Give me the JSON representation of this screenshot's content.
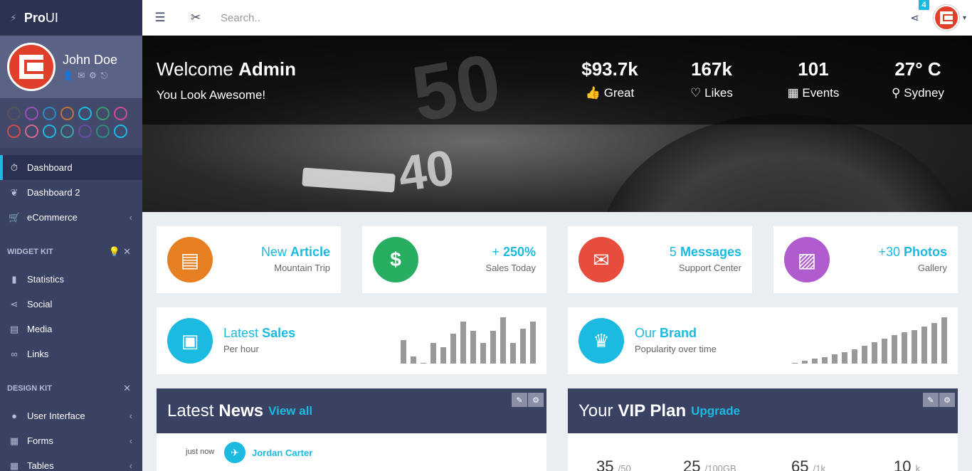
{
  "brand": {
    "bold": "Pro",
    "light": "UI"
  },
  "user": {
    "name": "John Doe"
  },
  "theme_colors": [
    "#555",
    "#9b4dba",
    "#2a8cbd",
    "#c0703a",
    "#1bbae1",
    "#3a9a6a",
    "#d04a9a",
    "#d04a4a",
    "#d06a8a",
    "#1bbae1",
    "#3aa3a3",
    "#6a4aa3",
    "#2a8c7a",
    "#1bbae1"
  ],
  "search": {
    "placeholder": "Search.."
  },
  "notifications": {
    "count": "4"
  },
  "nav": {
    "dashboard": "Dashboard",
    "dashboard2": "Dashboard 2",
    "ecommerce": "eCommerce",
    "widget_kit": "WIDGET KIT",
    "statistics": "Statistics",
    "social": "Social",
    "media": "Media",
    "links": "Links",
    "design_kit": "DESIGN KIT",
    "user_interface": "User Interface",
    "forms": "Forms",
    "tables": "Tables"
  },
  "hero": {
    "welcome": "Welcome",
    "admin": "Admin",
    "tagline": "You Look Awesome!",
    "stats": [
      {
        "value": "$93.7k",
        "label": "Great"
      },
      {
        "value": "167k",
        "label": "Likes"
      },
      {
        "value": "101",
        "label": "Events"
      },
      {
        "value": "27° C",
        "label": "Sydney"
      }
    ]
  },
  "mini_widgets": [
    {
      "light": "New",
      "bold": "Article",
      "sub": "Mountain Trip"
    },
    {
      "light": "+",
      "bold": "250%",
      "sub": "Sales Today"
    },
    {
      "light": "5",
      "bold": "Messages",
      "sub": "Support Center"
    },
    {
      "light": "+30",
      "bold": "Photos",
      "sub": "Gallery"
    }
  ],
  "latest_sales": {
    "light": "Latest",
    "bold": "Sales",
    "sub": "Per hour"
  },
  "our_brand": {
    "light": "Our",
    "bold": "Brand",
    "sub": "Popularity over time"
  },
  "chart_data": [
    {
      "type": "bar",
      "values": [
        50,
        15,
        1,
        45,
        35,
        65,
        90,
        70,
        45,
        70,
        100,
        45,
        75,
        90
      ]
    },
    {
      "type": "bar",
      "values": [
        2,
        6,
        10,
        14,
        20,
        24,
        30,
        38,
        46,
        54,
        62,
        68,
        72,
        80,
        88,
        100
      ]
    }
  ],
  "news": {
    "title_light": "Latest",
    "title_bold": "News",
    "link": "View all",
    "time": "just now",
    "name": "Jordan Carter"
  },
  "vip": {
    "title_light": "Your",
    "title_bold": "VIP Plan",
    "link": "Upgrade",
    "items": [
      {
        "value": "35",
        "max": "/50"
      },
      {
        "value": "25",
        "max": "/100GB"
      },
      {
        "value": "65",
        "max": "/1k"
      },
      {
        "value": "10",
        "max": "k"
      }
    ]
  }
}
